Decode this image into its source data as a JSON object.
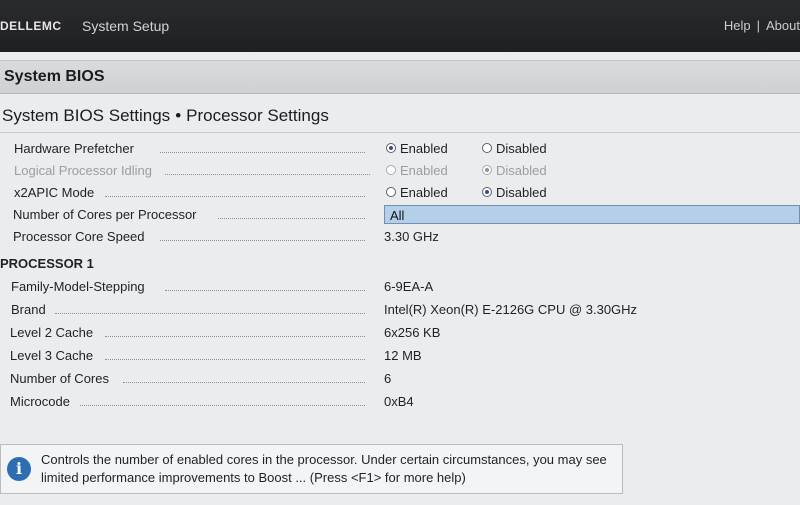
{
  "header": {
    "brand": "DELLEMC",
    "app_title": "System Setup",
    "links": [
      "Help",
      "About"
    ]
  },
  "page": {
    "title": "System BIOS",
    "breadcrumb": [
      "System BIOS Settings",
      "Processor Settings"
    ],
    "breadcrumb_separator": "•"
  },
  "settings": [
    {
      "label": "Hardware Prefetcher",
      "type": "radio",
      "options": [
        "Enabled",
        "Disabled"
      ],
      "selected": "Enabled",
      "disabled": false
    },
    {
      "label": "Logical Processor Idling",
      "type": "radio",
      "options": [
        "Enabled",
        "Disabled"
      ],
      "selected": "Disabled",
      "disabled": true
    },
    {
      "label": "x2APIC Mode",
      "type": "radio",
      "options": [
        "Enabled",
        "Disabled"
      ],
      "selected": "Disabled",
      "disabled": false
    },
    {
      "label": "Number of Cores per Processor",
      "type": "select",
      "value": "All",
      "focused": true
    },
    {
      "label": "Processor Core Speed",
      "type": "text",
      "value": "3.30 GHz"
    }
  ],
  "processor": {
    "heading": "PROCESSOR 1",
    "fields": [
      {
        "label": "Family-Model-Stepping",
        "value": "6-9EA-A"
      },
      {
        "label": "Brand",
        "value": "Intel(R) Xeon(R) E-2126G CPU @ 3.30GHz"
      },
      {
        "label": "Level 2 Cache",
        "value": "6x256 KB"
      },
      {
        "label": "Level 3 Cache",
        "value": "12 MB"
      },
      {
        "label": "Number of Cores",
        "value": "6"
      },
      {
        "label": "Microcode",
        "value": "0xB4"
      }
    ]
  },
  "help": {
    "icon": "info-icon",
    "text": "Controls the number of enabled cores in the processor. Under certain circumstances, you may see limited performance improvements to Boost ... (Press <F1> for more help)"
  },
  "colors": {
    "header_bg": "#222327",
    "select_highlight": "#b4cfe7",
    "info_icon": "#2f6db3"
  }
}
